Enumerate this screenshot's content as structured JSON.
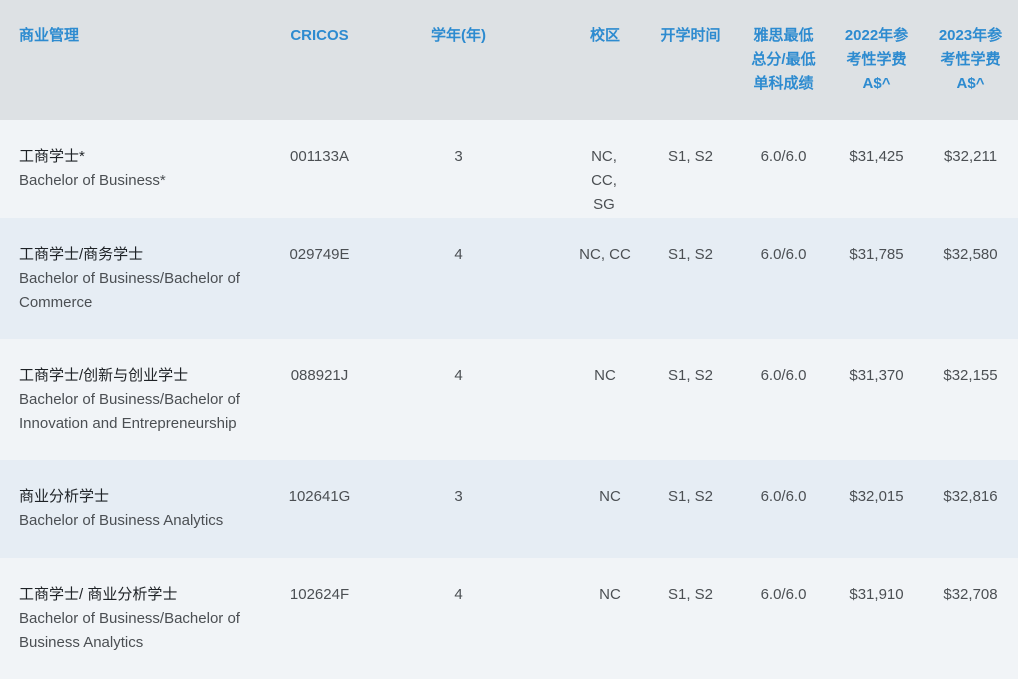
{
  "headers": {
    "program": "商业管理",
    "cricos": "CRICOS",
    "years": "学年(年)",
    "campus": "校区",
    "intake": "开学时间",
    "ielts": "雅思最低总分/最低单科成绩",
    "fee2022": "2022年参考性学费A$^",
    "fee2023": "2023年参考性学费A$^"
  },
  "rows": [
    {
      "zh": "工商学士*",
      "en": "Bachelor of Business*",
      "cricos": "001133A",
      "years": "3",
      "campus": "NC, CC, SG",
      "intake": "S1, S2",
      "ielts": "6.0/6.0",
      "fee2022": "$31,425",
      "fee2023": "$32,211"
    },
    {
      "zh": "工商学士/商务学士",
      "en": "Bachelor of Business/Bachelor of Commerce",
      "cricos": "029749E",
      "years": "4",
      "campus": "NC, CC",
      "intake": "S1, S2",
      "ielts": "6.0/6.0",
      "fee2022": "$31,785",
      "fee2023": "$32,580"
    },
    {
      "zh": "工商学士/创新与创业学士",
      "en": "Bachelor of Business/Bachelor of Innovation and Entrepreneurship",
      "cricos": "088921J",
      "years": "4",
      "campus": "NC",
      "intake": "S1, S2",
      "ielts": "6.0/6.0",
      "fee2022": "$31,370",
      "fee2023": "$32,155"
    },
    {
      "zh": "商业分析学士",
      "en": "Bachelor of Business Analytics",
      "cricos": "102641G",
      "years": "3",
      "campus": "NC",
      "intake": "S1, S2",
      "ielts": "6.0/6.0",
      "fee2022": "$32,015",
      "fee2023": "$32,816"
    },
    {
      "zh": "工商学士/ 商业分析学士",
      "en": "Bachelor of Business/Bachelor of Business Analytics",
      "cricos": "102624F",
      "years": "4",
      "campus": "NC",
      "intake": "S1, S2",
      "ielts": "6.0/6.0",
      "fee2022": "$31,910",
      "fee2023": "$32,708"
    }
  ]
}
